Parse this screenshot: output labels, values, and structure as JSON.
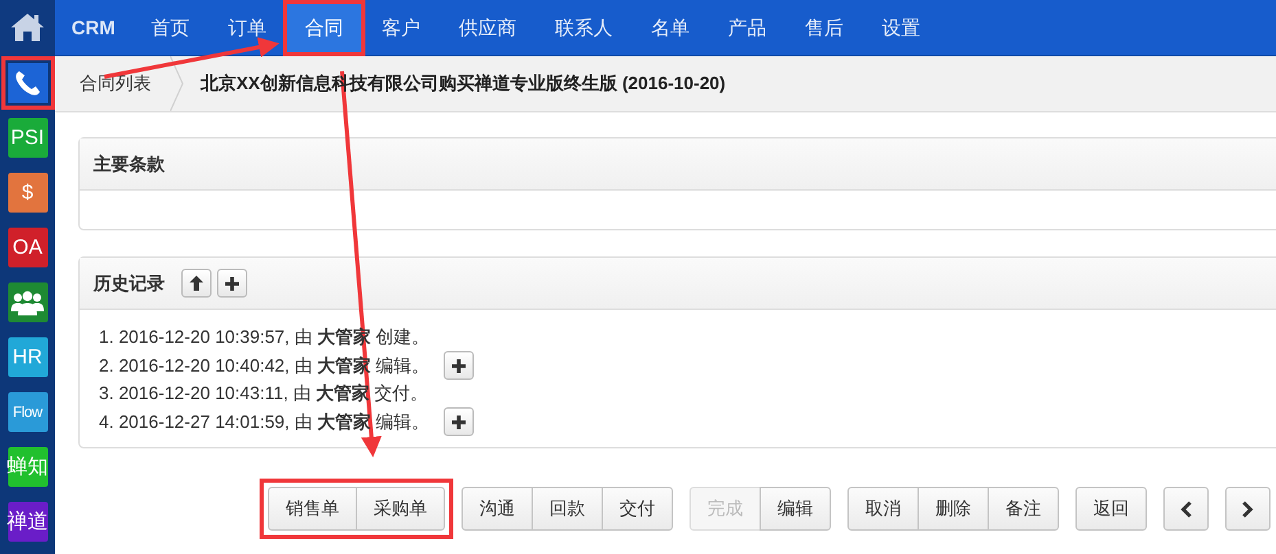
{
  "nav": {
    "brand": "CRM",
    "items": [
      {
        "label": "首页",
        "selected": false,
        "highlighted": false
      },
      {
        "label": "订单",
        "selected": false,
        "highlighted": false
      },
      {
        "label": "合同",
        "selected": true,
        "highlighted": true
      },
      {
        "label": "客户",
        "selected": false,
        "highlighted": false
      },
      {
        "label": "供应商",
        "selected": false,
        "highlighted": false
      },
      {
        "label": "联系人",
        "selected": false,
        "highlighted": false
      },
      {
        "label": "名单",
        "selected": false,
        "highlighted": false
      },
      {
        "label": "产品",
        "selected": false,
        "highlighted": false
      },
      {
        "label": "售后",
        "selected": false,
        "highlighted": false
      },
      {
        "label": "设置",
        "selected": false,
        "highlighted": false
      }
    ]
  },
  "sidebar": {
    "items": [
      {
        "kind": "phone",
        "color": "#1c64d6",
        "highlighted": true
      },
      {
        "kind": "text",
        "label": "PSI",
        "color": "#1aab3a",
        "highlighted": false
      },
      {
        "kind": "text",
        "label": "$",
        "color": "#e2743e",
        "highlighted": false
      },
      {
        "kind": "text",
        "label": "OA",
        "color": "#d0202a",
        "highlighted": false
      },
      {
        "kind": "team",
        "color": "#1e8a33",
        "highlighted": false
      },
      {
        "kind": "text",
        "label": "HR",
        "color": "#21a8d8",
        "highlighted": false
      },
      {
        "kind": "text",
        "label": "Flow",
        "color": "#2a9ad8",
        "highlighted": false
      },
      {
        "kind": "text",
        "label": "蝉知",
        "color": "#21c02e",
        "highlighted": false
      },
      {
        "kind": "text",
        "label": "禅道",
        "color": "#6a1dc8",
        "highlighted": false
      }
    ]
  },
  "breadcrumb": {
    "parent": "合同列表",
    "title": "北京XX创新信息科技有限公司购买禅道专业版终生版 (2016-10-20)"
  },
  "terms_panel": {
    "title": "主要条款"
  },
  "history_panel": {
    "title": "历史记录",
    "entries": [
      {
        "text": "1. 2016-12-20 10:39:57, 由 **大管家** 创建。",
        "has_details": false
      },
      {
        "text": "2. 2016-12-20 10:40:42, 由 **大管家** 编辑。",
        "has_details": true
      },
      {
        "text": "3. 2016-12-20 10:43:11, 由 **大管家** 交付。",
        "has_details": false
      },
      {
        "text": "4. 2016-12-27 14:01:59, 由 **大管家** 编辑。",
        "has_details": true
      }
    ]
  },
  "action_groups": [
    {
      "highlighted": true,
      "buttons": [
        {
          "kind": "text",
          "label": "销售单",
          "disabled": false
        },
        {
          "kind": "text",
          "label": "采购单",
          "disabled": false
        }
      ]
    },
    {
      "highlighted": false,
      "buttons": [
        {
          "kind": "text",
          "label": "沟通",
          "disabled": false
        },
        {
          "kind": "text",
          "label": "回款",
          "disabled": false
        },
        {
          "kind": "text",
          "label": "交付",
          "disabled": false
        }
      ]
    },
    {
      "highlighted": false,
      "buttons": [
        {
          "kind": "text",
          "label": "完成",
          "disabled": true
        },
        {
          "kind": "text",
          "label": "编辑",
          "disabled": false
        }
      ]
    },
    {
      "highlighted": false,
      "buttons": [
        {
          "kind": "text",
          "label": "取消",
          "disabled": false
        },
        {
          "kind": "text",
          "label": "删除",
          "disabled": false
        },
        {
          "kind": "text",
          "label": "备注",
          "disabled": false
        }
      ]
    },
    {
      "highlighted": false,
      "buttons": [
        {
          "kind": "text",
          "label": "返回",
          "disabled": false
        }
      ]
    },
    {
      "highlighted": false,
      "buttons": [
        {
          "kind": "prev",
          "disabled": false
        }
      ]
    },
    {
      "highlighted": false,
      "buttons": [
        {
          "kind": "next",
          "disabled": false
        }
      ]
    }
  ]
}
